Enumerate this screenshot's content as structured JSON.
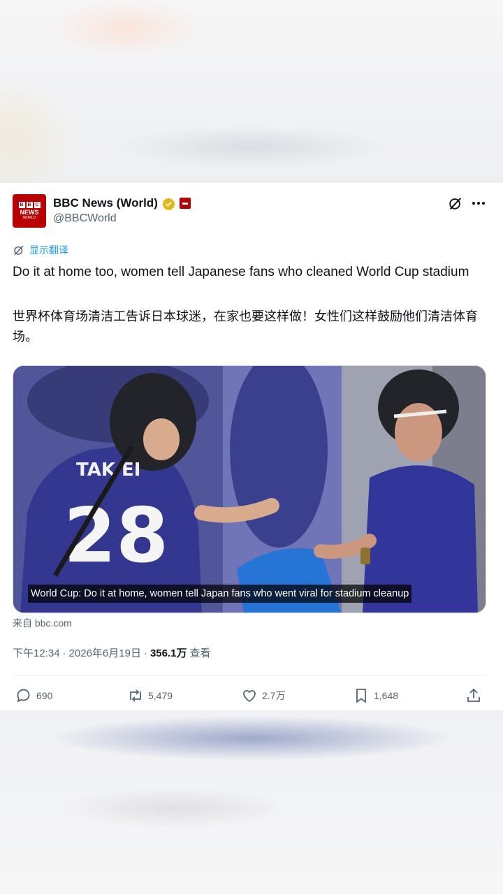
{
  "tweet": {
    "author": {
      "display_name": "BBC News (World)",
      "handle": "@BBCWorld",
      "avatar_letters": [
        "B",
        "B",
        "C"
      ],
      "avatar_news": "NEWS",
      "avatar_world": "WORLD"
    },
    "translate_label": "显示翻译",
    "text_en": "Do it at home too, women tell Japanese fans who cleaned World Cup stadium",
    "text_zh": "世界杯体育场清洁工告诉日本球迷，在家也要这样做！女性们这样鼓励他们清洁体育场。",
    "media": {
      "caption": "World Cup: Do it at home, women tell Japan fans who went viral for stadium cleanup",
      "jersey_name": "TAK  EI",
      "jersey_number": "28"
    },
    "source": "来自 bbc.com",
    "time": "下午12:34",
    "date": "2026年6月19日",
    "views": "356.1万",
    "views_label": "查看",
    "separator": "·",
    "stats": {
      "replies": "690",
      "retweets": "5,479",
      "likes": "2.7万",
      "bookmarks": "1,648"
    }
  },
  "colors": {
    "brand_red": "#b80000",
    "link_blue": "#1d9bf0",
    "verified_gold": "#e2b719",
    "text_primary": "#0f1419",
    "text_secondary": "#536471"
  },
  "icons": [
    "verified-badge-icon",
    "affiliate-badge-icon",
    "grok-icon",
    "more-icon",
    "translate-icon",
    "reply-icon",
    "retweet-icon",
    "like-icon",
    "bookmark-icon",
    "share-icon"
  ]
}
